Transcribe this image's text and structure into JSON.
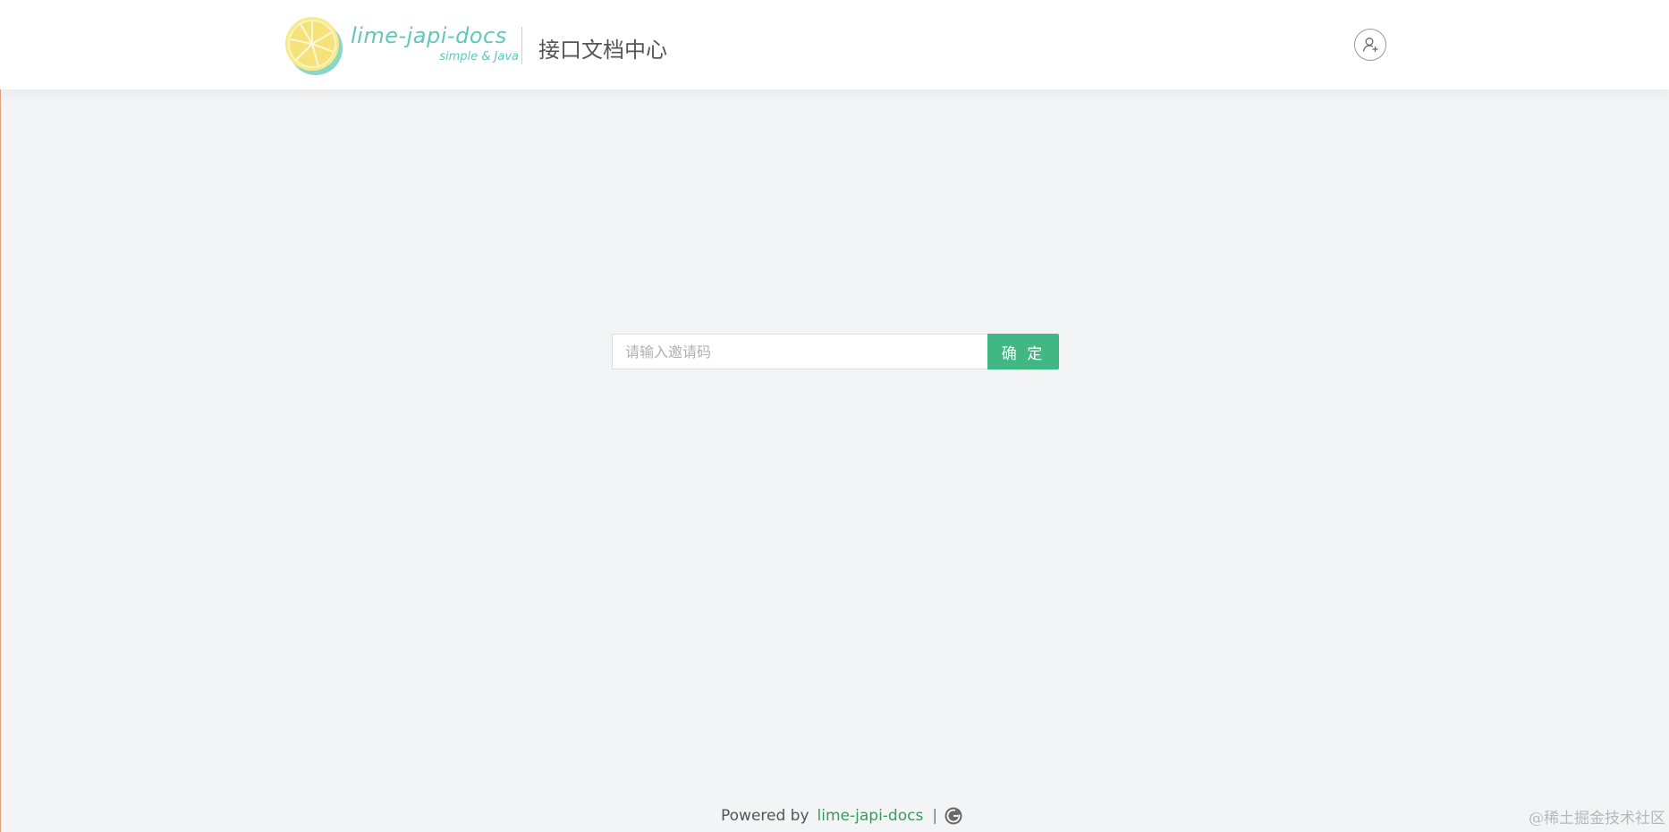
{
  "header": {
    "logo": {
      "name": "lime-japi-docs",
      "tagline": "simple & Java"
    },
    "site_title": "接口文档中心",
    "user_button_icon": "user-plus-icon"
  },
  "invite": {
    "placeholder": "请输入邀请码",
    "value": "",
    "confirm_label": "确 定"
  },
  "footer": {
    "powered_by": "Powered by",
    "link_label": "lime-japi-docs",
    "separator": "|",
    "icon": "github-icon"
  },
  "watermark": "@稀土掘金技术社区",
  "colors": {
    "accent": "#41b883",
    "logo_teal": "#5fc8bb",
    "background": "#f2f4f5",
    "lemon_yellow": "#f6e27a"
  }
}
